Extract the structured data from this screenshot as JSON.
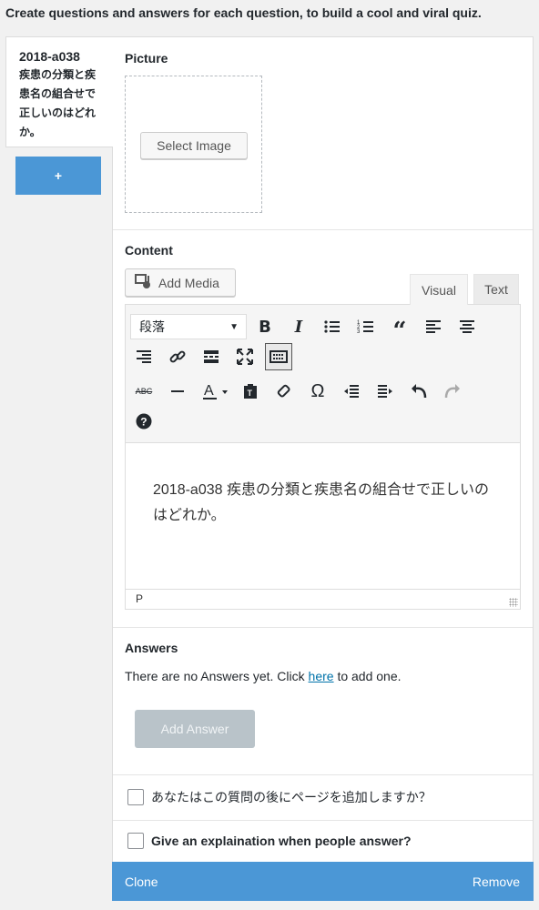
{
  "intro": "Create questions and answers for each question, to build a cool and viral quiz.",
  "side_tab": {
    "title": "2018-a038",
    "subtitle": "疾患の分類と疾患名の組合せで正しいのはどれか。"
  },
  "add_question_label": "+",
  "picture": {
    "heading": "Picture",
    "select_label": "Select Image"
  },
  "content": {
    "heading": "Content",
    "add_media_label": "Add Media",
    "tabs": [
      "Visual",
      "Text"
    ],
    "format_value": "段落",
    "body_text": "2018-a038 疾患の分類と疾患名の組合せで正しいのはどれか。",
    "path": "P",
    "toolbar_icons_row1": [
      "bold-icon",
      "italic-icon",
      "bulleted-list-icon",
      "numbered-list-icon",
      "blockquote-icon",
      "align-left-icon",
      "align-center-icon"
    ],
    "toolbar_icons_row2": [
      "align-right-icon",
      "insert-link-icon",
      "read-more-icon",
      "fullscreen-icon",
      "toolbar-toggle-icon"
    ],
    "toolbar_icons_row3": [
      "strikethrough-icon",
      "horizontal-line-icon",
      "text-color-icon",
      "paste-as-text-icon",
      "clear-formatting-icon",
      "special-character-icon",
      "outdent-icon",
      "indent-icon",
      "undo-icon",
      "redo-icon"
    ],
    "toolbar_icons_row4": [
      "help-icon"
    ]
  },
  "answers": {
    "heading": "Answers",
    "empty_prefix": "There are no Answers yet. Click ",
    "empty_link": "here",
    "empty_suffix": " to add one.",
    "add_label": "Add Answer"
  },
  "options": {
    "page_break_label": "あなたはこの質問の後にページを追加しますか？",
    "explanation_label": "Give an explaination when people answer?"
  },
  "footer": {
    "clone_label": "Clone",
    "remove_label": "Remove"
  }
}
